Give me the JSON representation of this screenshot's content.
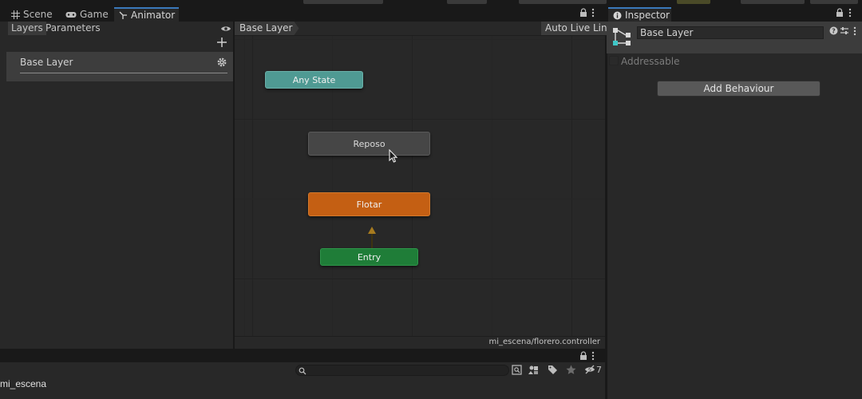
{
  "animator_window": {
    "tabs": [
      {
        "label": "Scene",
        "icon": "grid-icon"
      },
      {
        "label": "Game",
        "icon": "gamepad-icon"
      },
      {
        "label": "Animator",
        "icon": "animator-icon",
        "active": true
      }
    ],
    "left_panel": {
      "tabs": [
        "Layers",
        "Parameters"
      ],
      "selected_tab": "Layers",
      "layers": [
        {
          "name": "Base Layer"
        }
      ]
    },
    "breadcrumb": "Base Layer",
    "auto_live_link": "Auto Live Link",
    "states": {
      "any_state": "Any State",
      "reposo": "Reposo",
      "flotar": "Flotar",
      "entry": "Entry"
    },
    "controller_path": "mi_escena/florero.controller"
  },
  "inspector": {
    "tab_label": "Inspector",
    "object_name": "Base Layer",
    "addressable_label": "Addressable",
    "addressable_checked": false,
    "add_behaviour_label": "Add Behaviour"
  },
  "bottom_panel": {
    "scene_name": "mi_escena",
    "hidden_count": "7"
  },
  "colors": {
    "any_state": "#4f9a93",
    "default_state": "#464646",
    "flotar": "#c45f13",
    "entry": "#1f7d38",
    "active_tab_accent": "#3a79bb",
    "transition_arrow": "#a77b1f"
  }
}
